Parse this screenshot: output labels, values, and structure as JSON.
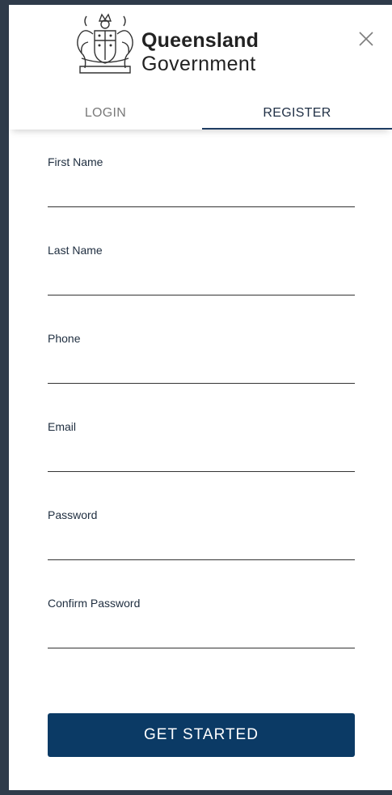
{
  "brand": {
    "line1": "Queensland",
    "line2": "Government",
    "crest_icon": "queensland-coat-of-arms-icon"
  },
  "header": {
    "close_icon": "close-icon"
  },
  "tabs": [
    {
      "label": "LOGIN",
      "active": false
    },
    {
      "label": "REGISTER",
      "active": true
    }
  ],
  "form": {
    "fields": [
      {
        "label": "First Name",
        "value": ""
      },
      {
        "label": "Last Name",
        "value": ""
      },
      {
        "label": "Phone",
        "value": ""
      },
      {
        "label": "Email",
        "value": ""
      },
      {
        "label": "Password",
        "value": ""
      },
      {
        "label": "Confirm Password",
        "value": ""
      }
    ],
    "submit_label": "GET STARTED"
  },
  "colors": {
    "primary": "#0b3a65",
    "active_tab_indicator": "#1f3d63",
    "inactive_tab_text": "#7a7a7a",
    "background_frame": "#2f3b4a"
  }
}
